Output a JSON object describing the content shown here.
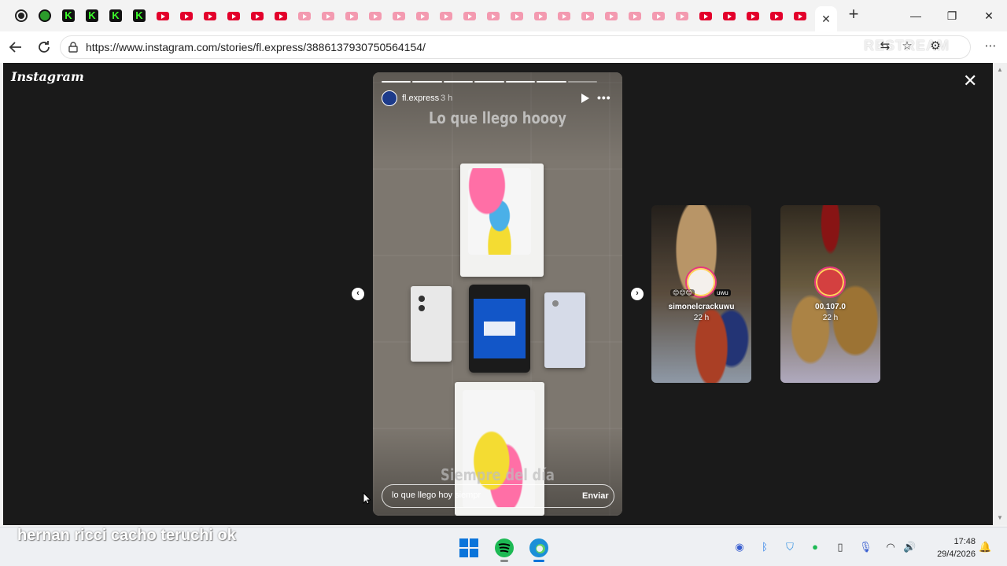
{
  "browser": {
    "tabs": {
      "favicons": [
        "record-icon",
        "football-icon",
        "kick-icon",
        "kick-icon",
        "kick-icon",
        "kick-icon",
        "youtube-icon",
        "youtube-icon",
        "youtube-icon",
        "youtube-icon",
        "youtube-icon",
        "youtube-icon",
        "youtube-icon-pale",
        "youtube-icon-pale",
        "youtube-icon-pale",
        "youtube-icon-pale",
        "youtube-icon-pale",
        "youtube-icon-pale",
        "youtube-icon-pale",
        "youtube-icon-pale",
        "youtube-icon-pale",
        "youtube-icon-pale",
        "youtube-icon-pale",
        "youtube-icon-pale",
        "youtube-icon-pale",
        "youtube-icon-pale",
        "youtube-icon-pale",
        "youtube-icon-pale",
        "youtube-icon-pale",
        "youtube-icon",
        "youtube-icon",
        "youtube-icon",
        "youtube-icon",
        "youtube-icon"
      ],
      "active_close_glyph": "✕",
      "new_tab_glyph": "+"
    },
    "window_controls": {
      "minimize": "—",
      "restore": "❐",
      "close": "✕"
    },
    "address": {
      "url": "https://www.instagram.com/stories/fl.express/3886137930750564154/",
      "watermark": "RESTREAM"
    },
    "colors": {
      "youtube": "#e3002b",
      "kick": "#3cff2a",
      "page_bg": "#1a1a1a"
    }
  },
  "instagram": {
    "logo": "Instagram",
    "story": {
      "username": "fl.express",
      "time": "3 h",
      "top_caption": "Lo que llego hoooy",
      "bottom_caption": "Siempre del día",
      "reply_value": "lo que llego hoy siempr",
      "send_label": "Enviar",
      "progress_segments": 7,
      "progress_active": 6
    },
    "next_stories": [
      {
        "username": "simonelcrackuwu",
        "time": "22 h",
        "sticker": "😊😊😊",
        "tag": "uwu"
      },
      {
        "username": "00.107.0",
        "time": "22 h"
      }
    ]
  },
  "overlay": {
    "text": "hernan ricci cacho teruchi ok"
  },
  "taskbar": {
    "time": "17:48",
    "date": "29/4/2026"
  }
}
